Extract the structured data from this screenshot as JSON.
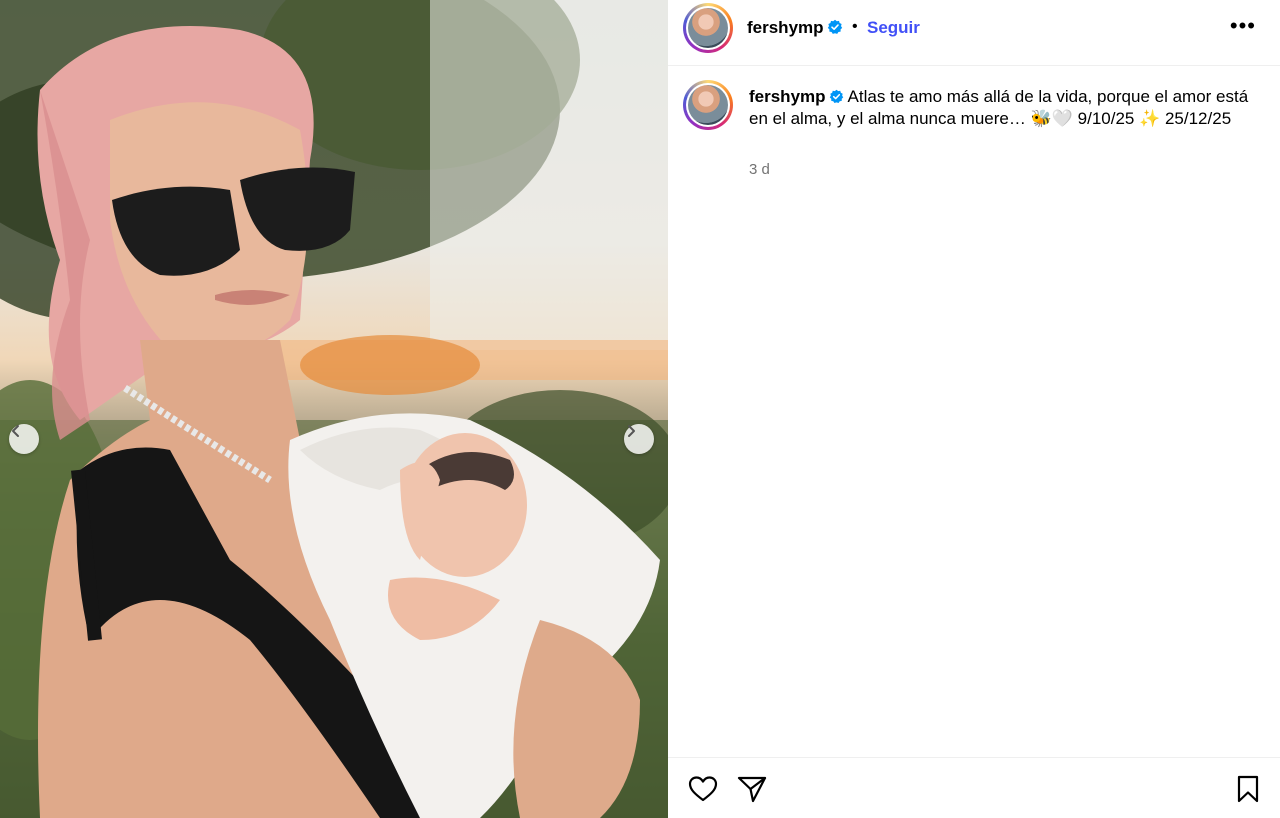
{
  "post": {
    "username": "fershymp",
    "follow_label": "Seguir",
    "separator": "•",
    "more_label": "•••",
    "caption_text": "Atlas te amo más allá de la vida, porque el amor está en el alma, y el alma nunca muere… 🐝🤍 9/10/25 ✨ 25/12/25",
    "time_ago": "3 d"
  },
  "icons": {
    "verified": "verified-badge-icon",
    "prev": "chevron-left-icon",
    "next": "chevron-right-icon",
    "like": "heart-icon",
    "share": "paper-plane-icon",
    "save": "bookmark-icon",
    "more": "more-options-icon"
  },
  "colors": {
    "follow_blue": "#4150f7",
    "verified_blue": "#0095f6",
    "time_gray": "#737373",
    "divider": "#efefef"
  }
}
